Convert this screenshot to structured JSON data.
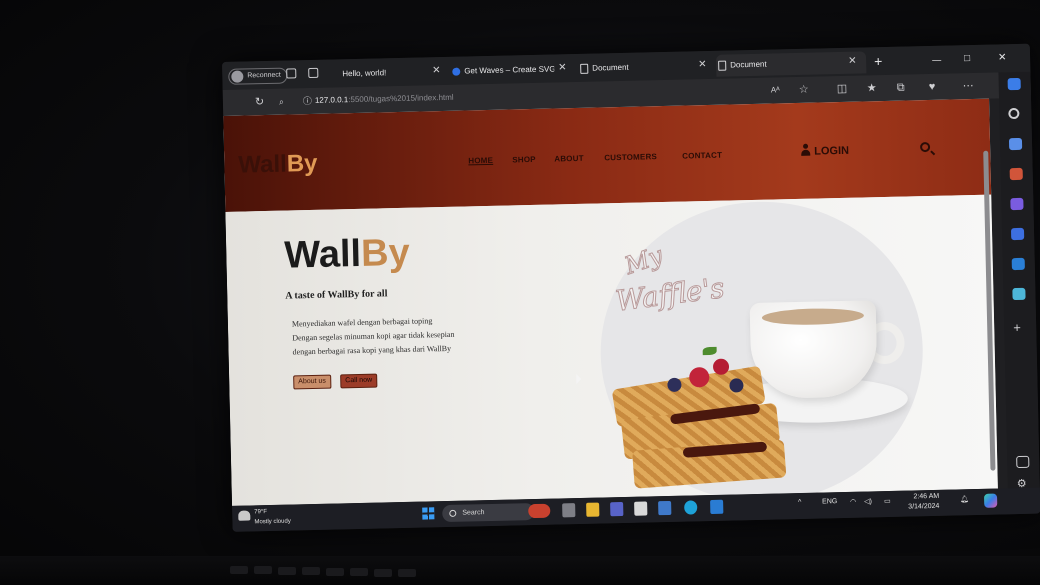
{
  "browser": {
    "profile_label": "Reconnect",
    "tabs": [
      {
        "title": "Hello, world!"
      },
      {
        "title": "Get Waves – Create SVG wa"
      },
      {
        "title": "Document"
      },
      {
        "title": "Document"
      }
    ],
    "new_tab": "+",
    "window_buttons": [
      "—",
      "□",
      "✕"
    ],
    "url_host": "127.0.0.1",
    "url_path": ":5500/tugas%2015/index.html"
  },
  "site": {
    "logo_part1": "Wall",
    "logo_part2": "By",
    "nav": [
      "HOME",
      "SHOP",
      "ABOUT",
      "CUSTOMERS",
      "CONTACT"
    ],
    "login": "LOGIN",
    "hero": {
      "title_part1": "Wall",
      "title_part2": "By",
      "tagline": "A taste of WallBy for all",
      "desc_lines": [
        "Menyediakan wafel dengan berbagai toping",
        "Dengan segelas minuman kopi agar tidak kesepian",
        "dengan berbagai rasa kopi yang khas dari WallBy"
      ],
      "button_about": "About us",
      "button_call": "Call now",
      "script_line1": "My",
      "script_line2": "Waffle's"
    }
  },
  "taskbar": {
    "weather_temp": "79°F",
    "weather_desc": "Mostly cloudy",
    "search_label": "Search",
    "language": "ENG",
    "time": "2:46 AM",
    "date": "3/14/2024"
  },
  "colors": {
    "header_red": "#8a2a14",
    "brand_tan": "#c58a4e",
    "taskbar": "#1d1e24"
  }
}
